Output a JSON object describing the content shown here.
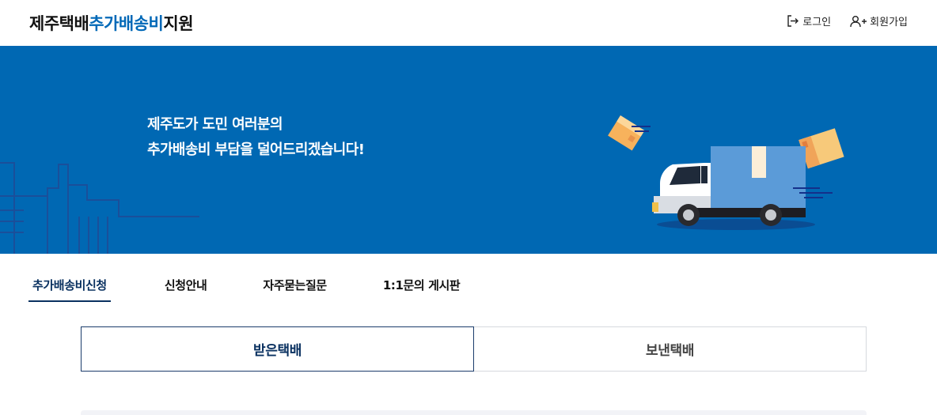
{
  "header": {
    "logo_part1": "제주택배",
    "logo_part2": "추가배송비",
    "logo_part3": "지원",
    "login_label": "로그인",
    "signup_label": "회원가입",
    "login_icon": "login-icon",
    "signup_icon": "user-plus-icon"
  },
  "banner": {
    "line1": "제주도가 도민 여러분의",
    "line2": "추가배송비 부담을 덜어드리겠습니다!"
  },
  "tabs": [
    {
      "label": "추가배송비신청",
      "active": true
    },
    {
      "label": "신청안내",
      "active": false
    },
    {
      "label": "자주묻는질문",
      "active": false
    },
    {
      "label": "1:1문의 게시판",
      "active": false
    }
  ],
  "toggle": {
    "received_label": "받은택배",
    "sent_label": "보낸택배",
    "selected": "received"
  },
  "colors": {
    "brand_blue": "#0068b7",
    "banner_bg": "#0068b3",
    "navy": "#0a3160",
    "truck_cargo": "#5b9bd8",
    "box_orange": "#f7b25c"
  }
}
